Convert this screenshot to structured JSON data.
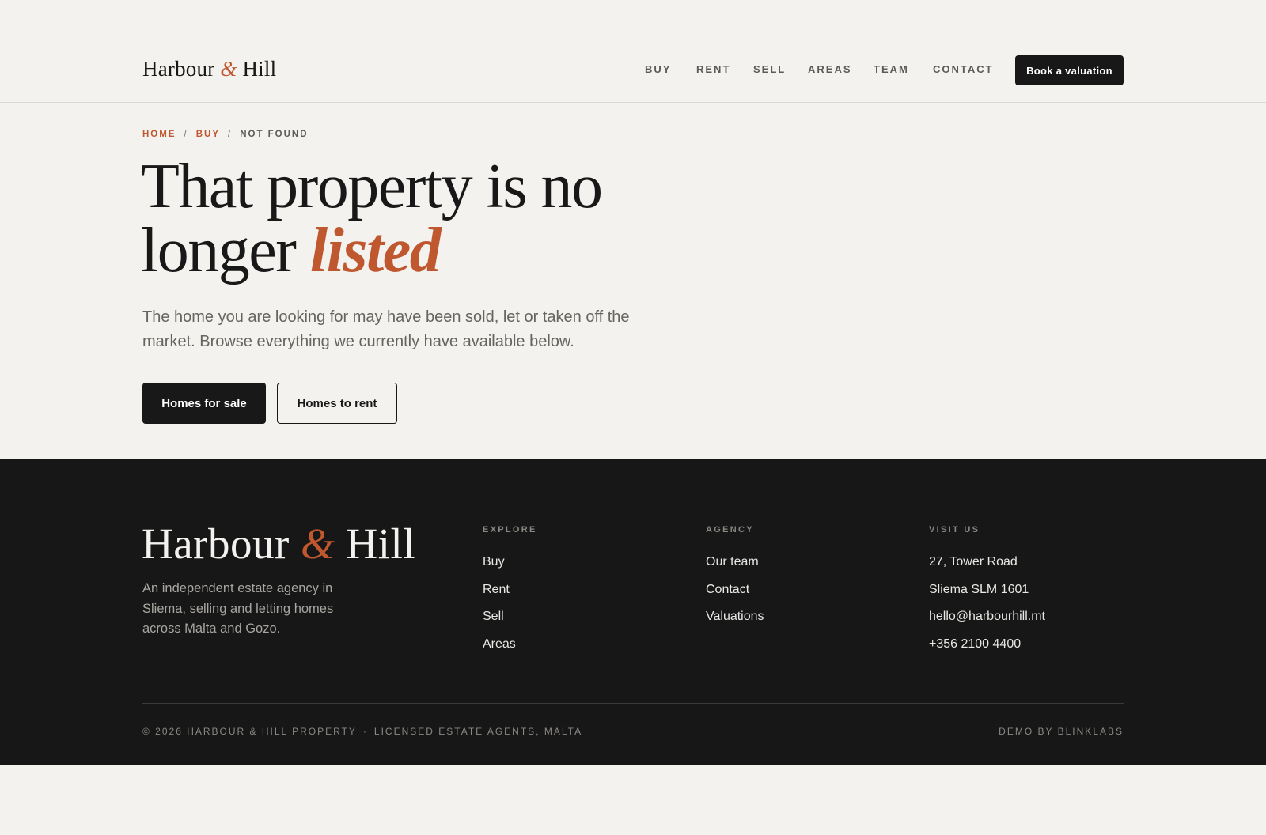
{
  "brand": {
    "name_part1": "Harbour",
    "ampersand": "&",
    "name_part2": "Hill"
  },
  "nav": {
    "items": [
      "BUY",
      "RENT",
      "SELL",
      "AREAS",
      "TEAM",
      "CONTACT"
    ],
    "cta_label": "Book a valuation"
  },
  "breadcrumb": {
    "home": "HOME",
    "section": "BUY",
    "current": "NOT FOUND",
    "separator": "/"
  },
  "hero": {
    "title_main": "That property is no longer",
    "title_accent": "listed",
    "description": "The home you are looking for may have been sold, let or taken off the market. Browse everything we currently have available below.",
    "primary_button": "Homes for sale",
    "secondary_button": "Homes to rent"
  },
  "footer": {
    "blurb": "An independent estate agency in Sliema, selling and letting homes across Malta and Gozo.",
    "explore": {
      "heading": "EXPLORE",
      "items": [
        "Buy",
        "Rent",
        "Sell",
        "Areas"
      ]
    },
    "agency": {
      "heading": "AGENCY",
      "items": [
        "Our team",
        "Contact",
        "Valuations"
      ]
    },
    "visit": {
      "heading": "VISIT US",
      "items": [
        "27, Tower Road",
        "Sliema SLM 1601",
        "hello@harbourhill.mt",
        "+356 2100 4400"
      ]
    },
    "copyright": "© 2026 HARBOUR & HILL PROPERTY",
    "legal_separator": "·",
    "license": "LICENSED ESTATE AGENTS, MALTA",
    "credit": "DEMO BY BLINKLABS"
  },
  "colors": {
    "accent": "#c0582f",
    "ink": "#181818",
    "background": "#f3f2ef",
    "footer_bg": "#171717"
  }
}
